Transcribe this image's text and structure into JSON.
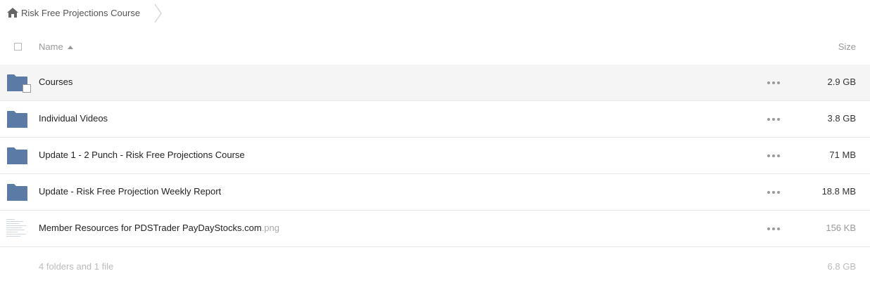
{
  "breadcrumb": {
    "icon": "home-icon",
    "label": "Risk Free Projections Course"
  },
  "header": {
    "name_label": "Name",
    "size_label": "Size",
    "sort_icon": "sort-ascending-icon"
  },
  "rows": [
    {
      "type": "folder",
      "name": "Courses",
      "ext": "",
      "size": "2.9 GB",
      "hover": true
    },
    {
      "type": "folder",
      "name": "Individual Videos",
      "ext": "",
      "size": "3.8 GB"
    },
    {
      "type": "folder",
      "name": "Update 1 - 2 Punch - Risk Free Projections Course",
      "ext": "",
      "size": "71 MB"
    },
    {
      "type": "folder",
      "name": "Update - Risk Free Projection Weekly Report",
      "ext": "",
      "size": "18.8 MB"
    },
    {
      "type": "image",
      "name": "Member Resources for PDSTrader PayDayStocks.com",
      "ext": ".png",
      "size": "156 KB"
    }
  ],
  "footer": {
    "summary": "4 folders and 1 file",
    "total_size": "6.8 GB"
  },
  "colors": {
    "folder": "#5b7aa6",
    "row_hover": "#f5f5f5",
    "border": "#e8e8e8"
  }
}
